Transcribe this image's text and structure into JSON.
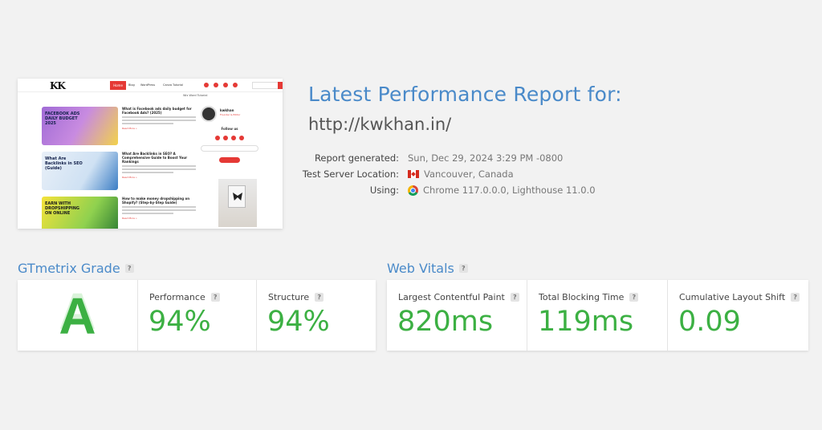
{
  "thumbnail": {
    "logo": "KK",
    "nav": [
      "Home",
      "Blog",
      "WordPress",
      "Canva Tutorial"
    ],
    "subnav": "Wix Word Tutorial",
    "cards": [
      {
        "text": "FACEBOOK ADS DAILY BUDGET 2025"
      },
      {
        "text": "What Are Backlinks in SEO (Guide)"
      },
      {
        "text": "EARN WITH DROPSHIPPING ON ONLINE"
      }
    ],
    "articles": [
      {
        "title": "What is Facebook ads daily budget for Facebook Ads? (2025)",
        "more": "Read More »"
      },
      {
        "title": "What Are Backlinks in SEO? A Comprehensive Guide to Boost Your Rankings",
        "more": "Read More »"
      },
      {
        "title": "How to make money dropshipping on Shopify? (Step-by-Step Guide)",
        "more": "Read More »"
      }
    ],
    "author_name": "kwkhan",
    "author_role": "Founder & Editor",
    "follow": "Follow us"
  },
  "report": {
    "title": "Latest Performance Report for:",
    "url": "http://kwkhan.in/",
    "meta": [
      {
        "label": "Report generated:",
        "value": "Sun, Dec 29, 2024 3:29 PM -0800"
      },
      {
        "label": "Test Server Location:",
        "value": "Vancouver, Canada",
        "icon": "canada-flag-icon"
      },
      {
        "label": "Using:",
        "value": "Chrome 117.0.0.0, Lighthouse 11.0.0",
        "icon": "chrome-icon"
      }
    ]
  },
  "grade": {
    "section_title": "GTmetrix Grade",
    "help": "?",
    "letter": "A",
    "letter_color": "#3cb043",
    "metrics": [
      {
        "label": "Performance",
        "value": "94%"
      },
      {
        "label": "Structure",
        "value": "94%"
      }
    ]
  },
  "vitals": {
    "section_title": "Web Vitals",
    "help": "?",
    "metrics": [
      {
        "label": "Largest Contentful Paint",
        "value": "820ms"
      },
      {
        "label": "Total Blocking Time",
        "value": "119ms"
      },
      {
        "label": "Cumulative Layout Shift",
        "value": "0.09"
      }
    ]
  },
  "colors": {
    "accent": "#4a8ac9",
    "good": "#3cb043",
    "brand_red": "#e53935"
  }
}
